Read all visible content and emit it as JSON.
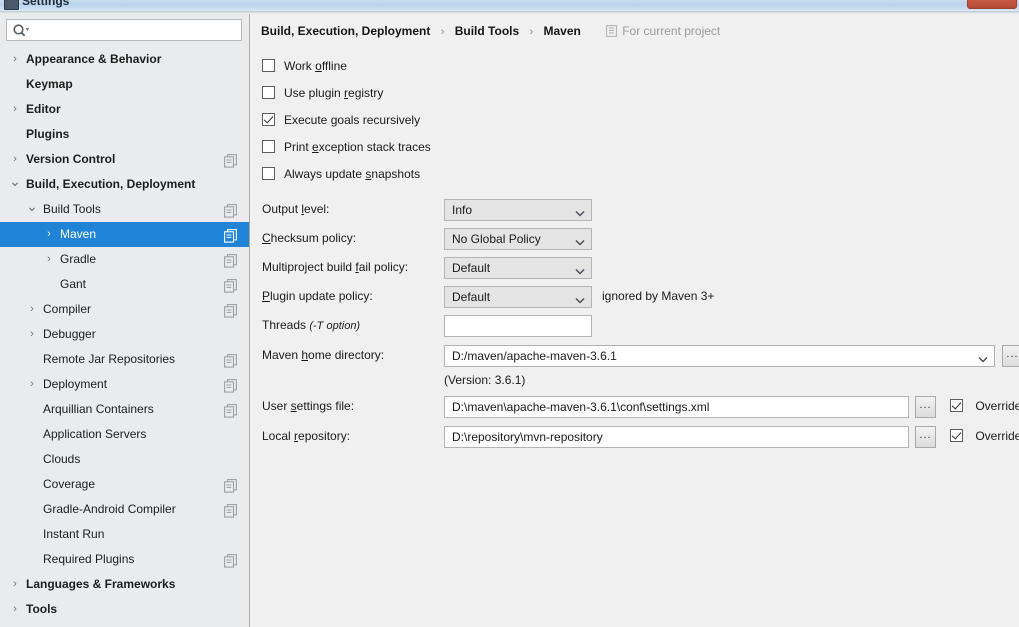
{
  "window": {
    "title": "Settings",
    "close_label": "✕"
  },
  "sidebar": {
    "search": {
      "value": "",
      "placeholder": "",
      "icon": "search-icon"
    },
    "items": [
      {
        "label": "Appearance & Behavior",
        "indent": 0,
        "bold": true,
        "arrow": "›",
        "module": false,
        "selected": false
      },
      {
        "label": "Keymap",
        "indent": 0,
        "bold": true,
        "arrow": "",
        "module": false,
        "selected": false
      },
      {
        "label": "Editor",
        "indent": 0,
        "bold": true,
        "arrow": "›",
        "module": false,
        "selected": false
      },
      {
        "label": "Plugins",
        "indent": 0,
        "bold": true,
        "arrow": "",
        "module": false,
        "selected": false
      },
      {
        "label": "Version Control",
        "indent": 0,
        "bold": true,
        "arrow": "›",
        "module": true,
        "selected": false
      },
      {
        "label": "Build, Execution, Deployment",
        "indent": 0,
        "bold": true,
        "arrow": "⌄",
        "module": false,
        "selected": false
      },
      {
        "label": "Build Tools",
        "indent": 1,
        "bold": false,
        "arrow": "⌄",
        "module": true,
        "selected": false
      },
      {
        "label": "Maven",
        "indent": 2,
        "bold": false,
        "arrow": "›",
        "module": true,
        "selected": true
      },
      {
        "label": "Gradle",
        "indent": 2,
        "bold": false,
        "arrow": "›",
        "module": true,
        "selected": false
      },
      {
        "label": "Gant",
        "indent": 2,
        "bold": false,
        "arrow": "",
        "module": true,
        "selected": false
      },
      {
        "label": "Compiler",
        "indent": 1,
        "bold": false,
        "arrow": "›",
        "module": true,
        "selected": false
      },
      {
        "label": "Debugger",
        "indent": 1,
        "bold": false,
        "arrow": "›",
        "module": false,
        "selected": false
      },
      {
        "label": "Remote Jar Repositories",
        "indent": 1,
        "bold": false,
        "arrow": "",
        "module": true,
        "selected": false
      },
      {
        "label": "Deployment",
        "indent": 1,
        "bold": false,
        "arrow": "›",
        "module": true,
        "selected": false
      },
      {
        "label": "Arquillian Containers",
        "indent": 1,
        "bold": false,
        "arrow": "",
        "module": true,
        "selected": false
      },
      {
        "label": "Application Servers",
        "indent": 1,
        "bold": false,
        "arrow": "",
        "module": false,
        "selected": false
      },
      {
        "label": "Clouds",
        "indent": 1,
        "bold": false,
        "arrow": "",
        "module": false,
        "selected": false
      },
      {
        "label": "Coverage",
        "indent": 1,
        "bold": false,
        "arrow": "",
        "module": true,
        "selected": false
      },
      {
        "label": "Gradle-Android Compiler",
        "indent": 1,
        "bold": false,
        "arrow": "",
        "module": true,
        "selected": false
      },
      {
        "label": "Instant Run",
        "indent": 1,
        "bold": false,
        "arrow": "",
        "module": false,
        "selected": false
      },
      {
        "label": "Required Plugins",
        "indent": 1,
        "bold": false,
        "arrow": "",
        "module": true,
        "selected": false
      },
      {
        "label": "Languages & Frameworks",
        "indent": 0,
        "bold": true,
        "arrow": "›",
        "module": false,
        "selected": false
      },
      {
        "label": "Tools",
        "indent": 0,
        "bold": true,
        "arrow": "›",
        "module": false,
        "selected": false
      }
    ]
  },
  "breadcrumb": {
    "segments": [
      "Build, Execution, Deployment",
      "Build Tools",
      "Maven"
    ],
    "separator": "›",
    "scope": "For current project",
    "scope_icon": "project-scope-icon"
  },
  "main": {
    "checkboxes": [
      {
        "label_pre": "Work ",
        "mnemonic": "o",
        "label_post": "ffline",
        "checked": false
      },
      {
        "label_pre": "Use plugin ",
        "mnemonic": "r",
        "label_post": "egistry",
        "checked": false
      },
      {
        "label_pre": "Execute ",
        "mnemonic": "g",
        "label_post": "oals recursively",
        "checked": true
      },
      {
        "label_pre": "Print ",
        "mnemonic": "e",
        "label_post": "xception stack traces",
        "checked": false
      },
      {
        "label_pre": "Always update ",
        "mnemonic": "s",
        "label_post": "napshots",
        "checked": false
      }
    ],
    "fields": {
      "output_level": {
        "label_pre": "Output ",
        "mnemonic": "l",
        "label_post": "evel:",
        "value": "Info"
      },
      "checksum_policy": {
        "label_pre": "",
        "mnemonic": "C",
        "label_post": "hecksum policy:",
        "value": "No Global Policy"
      },
      "multiproject_fail": {
        "label_pre": "Multiproject build ",
        "mnemonic": "f",
        "label_post": "ail policy:",
        "value": "Default"
      },
      "plugin_update": {
        "label_pre": "",
        "mnemonic": "P",
        "label_post": "lugin update policy:",
        "value": "Default",
        "hint": "ignored by Maven 3+"
      },
      "threads": {
        "label_pre": "Threads ",
        "mnemonic": "",
        "label_post": "",
        "label_italic": "(-T option)",
        "value": ""
      },
      "maven_home": {
        "label_pre": "Maven ",
        "mnemonic": "h",
        "label_post": "ome directory:",
        "value": "D:/maven/apache-maven-3.6.1",
        "version_note": "(Version: 3.6.1)",
        "browse": "..."
      },
      "user_settings": {
        "label_pre": "User ",
        "mnemonic": "s",
        "label_post": "ettings file:",
        "value": "D:\\maven\\apache-maven-3.6.1\\conf\\settings.xml",
        "browse": "...",
        "override_label": "Override",
        "override_checked": true
      },
      "local_repository": {
        "label_pre": "Local ",
        "mnemonic": "r",
        "label_post": "epository:",
        "value": "D:\\repository\\mvn-repository",
        "browse": "...",
        "override_label": "Override",
        "override_checked": true
      }
    }
  },
  "colors": {
    "selection": "#1f84d6",
    "sidebar_bg": "#e9ebed",
    "content_bg": "#f0f0f0",
    "close_button": "#c85a44"
  }
}
